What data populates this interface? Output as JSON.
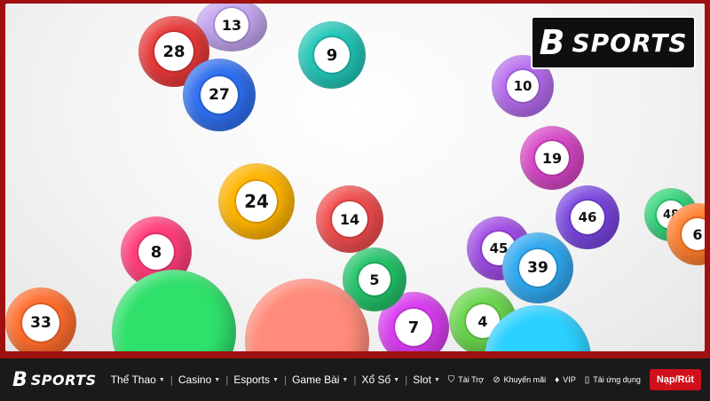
{
  "badge": {
    "mark": "B",
    "text": "SPORTS"
  },
  "hero": {
    "balls": [
      {
        "label": "13",
        "color": "#a77be6"
      },
      {
        "label": "28",
        "color": "#e83838"
      },
      {
        "label": "9",
        "color": "#21c7b7"
      },
      {
        "label": "27",
        "color": "#2f6ff0"
      },
      {
        "label": "10",
        "color": "#b66cf0"
      },
      {
        "label": "19",
        "color": "#d746c6"
      },
      {
        "label": "24",
        "color": "#ffb400"
      },
      {
        "label": "14",
        "color": "#f24d4d"
      },
      {
        "label": "8",
        "color": "#ff3d7a"
      },
      {
        "label": "45",
        "color": "#a04be6"
      },
      {
        "label": "39",
        "color": "#30a9f2"
      },
      {
        "label": "46",
        "color": "#7a45e0"
      },
      {
        "label": "48",
        "color": "#2fd67a"
      },
      {
        "label": "33",
        "color": "#ff6d2d"
      },
      {
        "label": "7",
        "color": "#d93cf0"
      },
      {
        "label": "5",
        "color": "#23c46a"
      },
      {
        "label": "6",
        "color": "#ff7e2b"
      },
      {
        "label": "4",
        "color": "#6bd64d"
      }
    ]
  },
  "nav": {
    "logo": {
      "mark": "B",
      "text": "SPORTS"
    },
    "items": [
      {
        "label": "Thể Thao"
      },
      {
        "label": "Casino"
      },
      {
        "label": "Esports"
      },
      {
        "label": "Game Bài"
      },
      {
        "label": "Xổ Số"
      },
      {
        "label": "Slot"
      }
    ],
    "utilities": [
      {
        "label": "Tài Trợ",
        "icon": "sponsor-icon"
      },
      {
        "label": "Khuyến mãi",
        "icon": "promo-icon"
      },
      {
        "label": "VIP",
        "icon": "vip-icon"
      },
      {
        "label": "Tải ứng dụng",
        "icon": "download-icon"
      }
    ],
    "cta": "Nạp/Rút"
  }
}
